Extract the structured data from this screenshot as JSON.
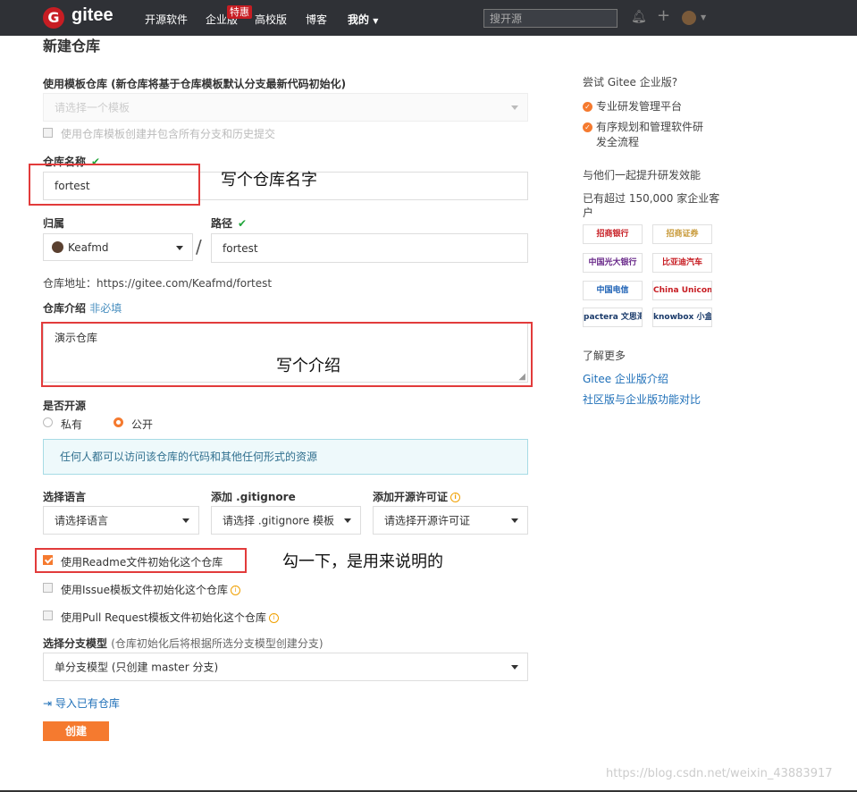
{
  "nav": {
    "logo_letter": "G",
    "logo_text": "gitee",
    "items": [
      "开源软件",
      "企业版",
      "高校版",
      "博客",
      "我的"
    ],
    "badge": "特惠",
    "search_placeholder": "搜开源"
  },
  "form": {
    "title": "新建仓库",
    "template_label": "使用模板仓库 (新仓库将基于仓库模板默认分支最新代码初始化)",
    "template_placeholder": "请选择一个模板",
    "template_checkbox": "使用仓库模板创建并包含所有分支和历史提交",
    "name_label": "仓库名称",
    "name_value": "fortest",
    "owner_label": "归属",
    "owner_value": "Keafmd",
    "path_label": "路径",
    "path_value": "fortest",
    "slash": "/",
    "address": "仓库地址：https://gitee.com/Keafmd/fortest",
    "desc_label": "仓库介绍",
    "desc_optional": "非必填",
    "desc_value": "演示仓库",
    "open_label": "是否开源",
    "private_label": "私有",
    "public_label": "公开",
    "notice": "任何人都可以访问该仓库的代码和其他任何形式的资源",
    "lang_label": "选择语言",
    "lang_value": "请选择语言",
    "gitignore_label": "添加 .gitignore",
    "gitignore_value": "请选择 .gitignore 模板",
    "license_label": "添加开源许可证",
    "license_value": "请选择开源许可证",
    "readme_cb": "使用Readme文件初始化这个仓库",
    "issue_cb": "使用Issue模板文件初始化这个仓库",
    "pr_cb": "使用Pull Request模板文件初始化这个仓库",
    "branch_label": "选择分支模型",
    "branch_sub": "(仓库初始化后将根据所选分支模型创建分支)",
    "branch_value": "单分支模型 (只创建 master 分支)",
    "import_link": "导入已有仓库",
    "create_button": "创建"
  },
  "annotations": {
    "name": "写个仓库名字",
    "desc": "写个介绍",
    "readme": "勾一下，是用来说明的"
  },
  "sidebar": {
    "try": "尝试 Gitee 企业版?",
    "feature1": "专业研发管理平台",
    "feature2_line1": "有序规划和管理软件研",
    "feature2_line2": "发全流程",
    "together": "与他们一起提升研发效能",
    "count_line1": "已有超过 150,000 家企业客",
    "count_line2": "户",
    "logos": [
      "招商银行",
      "招商证券",
      "中国光大银行",
      "比亚迪汽车",
      "中国电信",
      "China Unicom",
      "pactera 文思海辉",
      "knowbox 小盒科技"
    ],
    "more": "了解更多",
    "link1": "Gitee 企业版介绍",
    "link2": "社区版与企业版功能对比"
  },
  "watermark": "https://blog.csdn.net/weixin_43883917"
}
